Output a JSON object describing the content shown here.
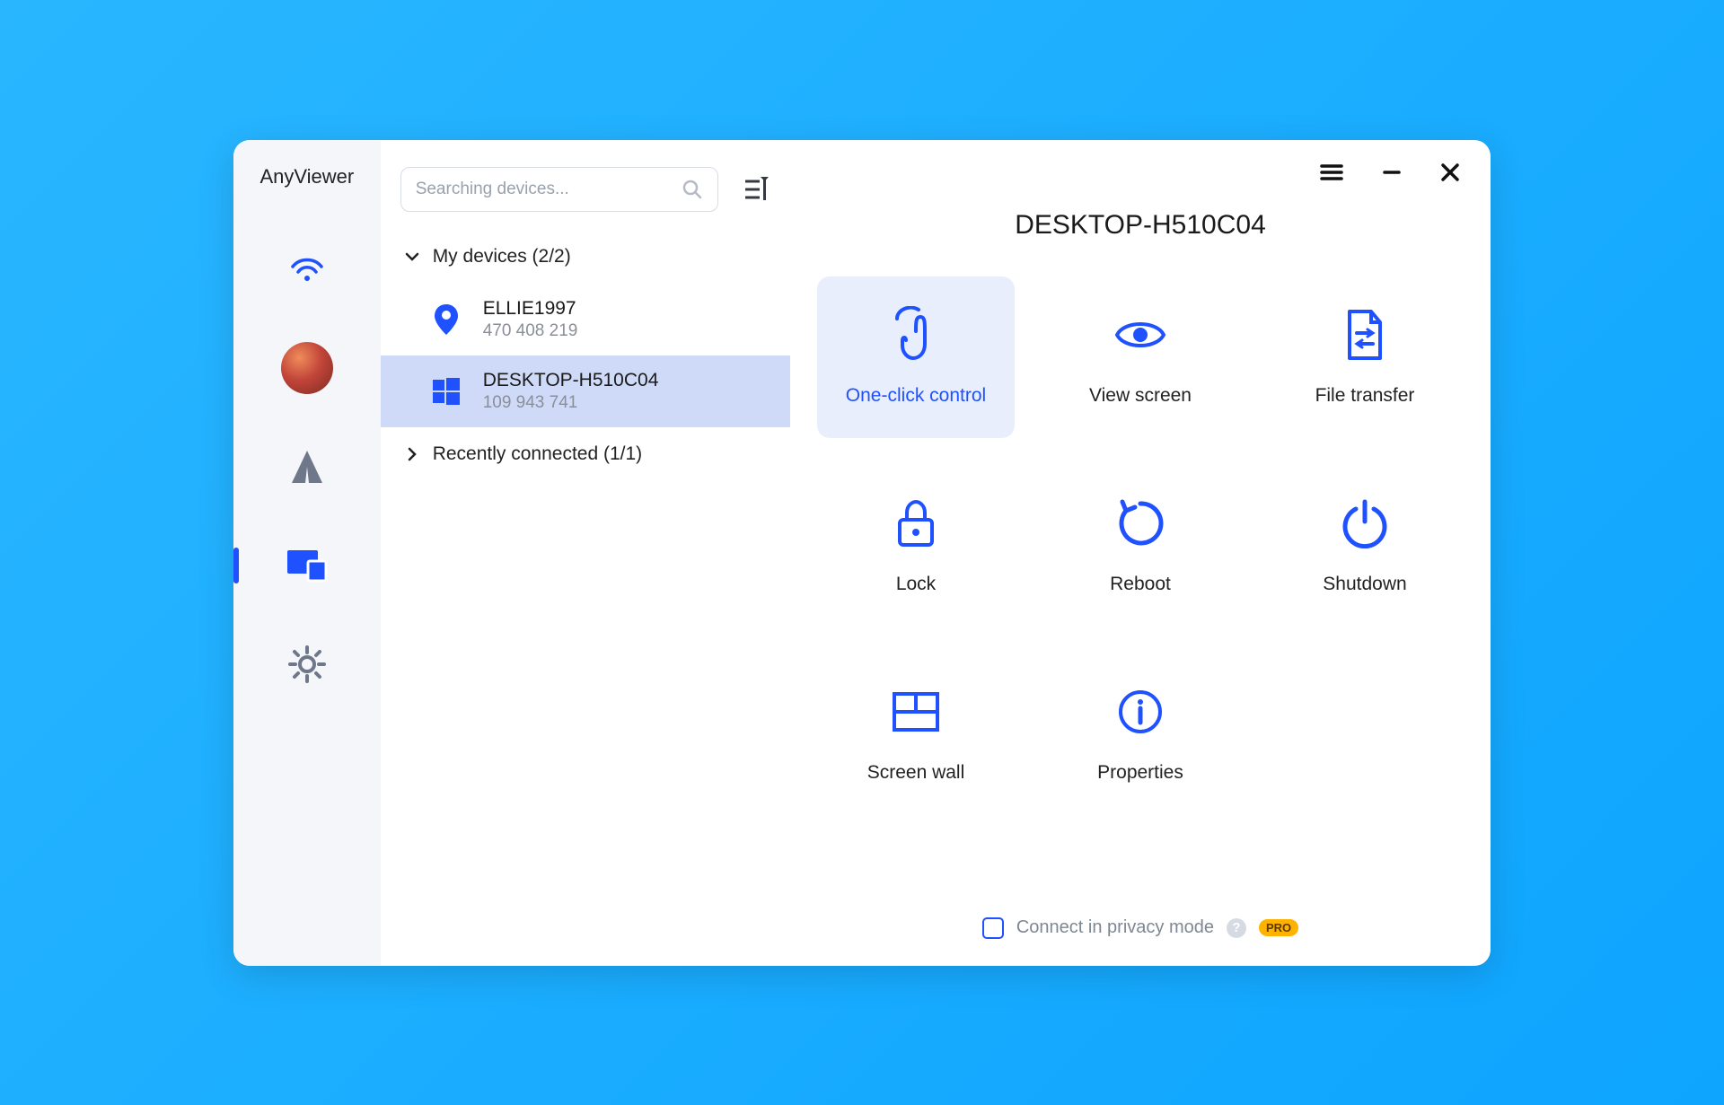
{
  "app": {
    "title": "AnyViewer"
  },
  "sidebar": {
    "items": [
      {
        "name": "nav-connection",
        "icon": "wifi-icon"
      },
      {
        "name": "nav-account",
        "icon": "avatar-icon"
      },
      {
        "name": "nav-road",
        "icon": "road-icon"
      },
      {
        "name": "nav-devices",
        "icon": "devices-icon",
        "active": true
      },
      {
        "name": "nav-settings",
        "icon": "gear-icon"
      }
    ]
  },
  "search": {
    "placeholder": "Searching devices..."
  },
  "groups": {
    "my_devices": {
      "label": "My devices (2/2)",
      "expanded": true,
      "items": [
        {
          "name": "ELLIE1997",
          "id": "470 408 219",
          "icon": "location-icon",
          "selected": false
        },
        {
          "name": "DESKTOP-H510C04",
          "id": "109 943 741",
          "icon": "windows-icon",
          "selected": true
        }
      ]
    },
    "recent": {
      "label": "Recently connected (1/1)",
      "expanded": false
    }
  },
  "detail": {
    "title": "DESKTOP-H510C04",
    "actions": [
      {
        "key": "one_click",
        "label": "One-click control",
        "icon": "touch-icon",
        "active": true
      },
      {
        "key": "view_screen",
        "label": "View screen",
        "icon": "eye-icon"
      },
      {
        "key": "file_transfer",
        "label": "File transfer",
        "icon": "file-transfer-icon"
      },
      {
        "key": "lock",
        "label": "Lock",
        "icon": "lock-icon"
      },
      {
        "key": "reboot",
        "label": "Reboot",
        "icon": "reboot-icon"
      },
      {
        "key": "shutdown",
        "label": "Shutdown",
        "icon": "power-icon"
      },
      {
        "key": "screen_wall",
        "label": "Screen wall",
        "icon": "grid-icon"
      },
      {
        "key": "properties",
        "label": "Properties",
        "icon": "info-icon"
      }
    ],
    "privacy": {
      "label": "Connect in privacy mode",
      "pro_badge": "PRO",
      "help": "?"
    }
  },
  "titlebar": {
    "menu": "menu-icon",
    "minimize": "minimize-icon",
    "close": "close-icon"
  },
  "colors": {
    "accent": "#1f51ff",
    "selected_bg": "#cedaf7",
    "active_tile": "#e8eefc"
  }
}
